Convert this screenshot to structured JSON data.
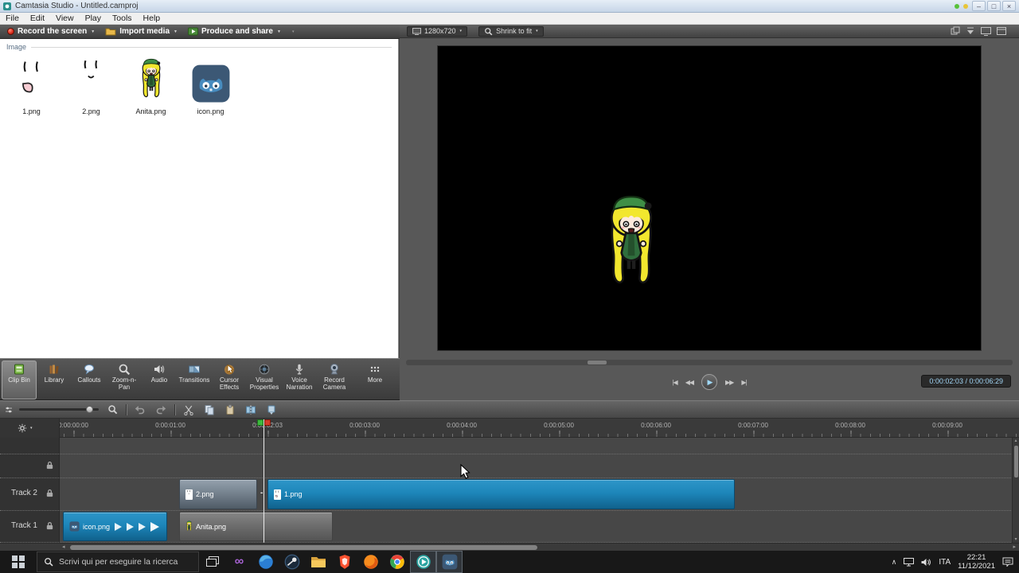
{
  "window": {
    "title": "Camtasia Studio - Untitled.camproj",
    "controls": {
      "minimize": "–",
      "maximize": "□",
      "close": "×"
    }
  },
  "menu": {
    "items": [
      "File",
      "Edit",
      "View",
      "Play",
      "Tools",
      "Help"
    ]
  },
  "main_toolbar": {
    "record_label": "Record the screen",
    "import_label": "Import media",
    "produce_label": "Produce and share"
  },
  "clip_bin": {
    "group_label": "Image",
    "items": [
      "1.png",
      "2.png",
      "Anita.png",
      "icon.png"
    ]
  },
  "tabs": {
    "active": "Clip Bin",
    "items": [
      "Clip Bin",
      "Library",
      "Callouts",
      "Zoom-n-Pan",
      "Audio",
      "Transitions",
      "Cursor Effects",
      "Visual Properties",
      "Voice Narration",
      "Record Camera",
      "More"
    ]
  },
  "preview": {
    "dimensions": "1280x720",
    "zoom_mode": "Shrink to fit",
    "time_display": "0:00:02:03 / 0:00:06:29"
  },
  "timeline": {
    "ruler_labels": [
      "0:00:00:00",
      "0:00:01:00",
      "0:00:02:03",
      "0:00:03:00",
      "0:00:04:00",
      "0:00:05:00",
      "0:00:06:00",
      "0:00:07:00",
      "0:00:08:00",
      "0:00:09:00"
    ],
    "tracks": [
      {
        "name": "Track 2",
        "clips": [
          "2.png",
          "1.png"
        ]
      },
      {
        "name": "Track 1",
        "clips": [
          "icon.png",
          "Anita.png"
        ]
      }
    ]
  },
  "taskbar": {
    "search_placeholder": "Scrivi qui per eseguire la ricerca",
    "language": "ITA",
    "time": "22:21",
    "date": "11/12/2021"
  },
  "glyphs": {
    "caret_down": "▼",
    "caret_small": "▾",
    "prev": "|◀",
    "rewind": "◀◀",
    "play": "▶",
    "forward": "▶▶",
    "next": "▶|",
    "scroll_left": "◂",
    "scroll_right": "▸",
    "scroll_up": "▴",
    "scroll_down": "▾",
    "fade_dash": "-",
    "vs_logo": "∞",
    "chevron_up": "∧"
  },
  "colors": {
    "accent_blue": "#1d86ba",
    "record_red": "#e03020",
    "playhead_green": "#3db83d",
    "playhead_red": "#d23b2a"
  }
}
